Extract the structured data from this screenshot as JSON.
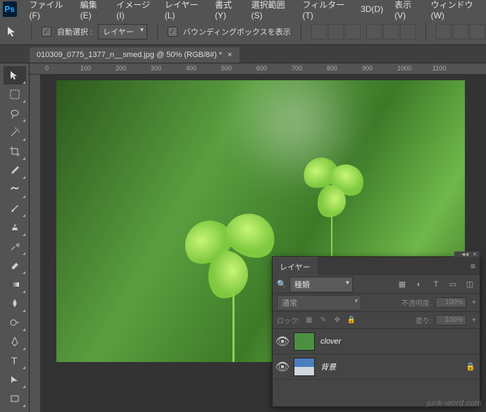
{
  "app": {
    "logo_text": "Ps"
  },
  "menu": [
    "ファイル(F)",
    "編集(E)",
    "イメージ(I)",
    "レイヤー(L)",
    "書式(Y)",
    "選択範囲(S)",
    "フィルター(T)",
    "3D(D)",
    "表示(V)",
    "ウィンドウ(W)"
  ],
  "options": {
    "auto_select_label": "自動選択 :",
    "auto_select_value": "レイヤー",
    "bbox_label": "バウンディングボックスを表示"
  },
  "document": {
    "tab_title": "010309_0775_1377_n__smed.jpg @ 50% (RGB/8#) *",
    "close_glyph": "×"
  },
  "ruler": {
    "ticks": [
      "0",
      "100",
      "200",
      "300",
      "400",
      "500",
      "600",
      "700",
      "800",
      "900",
      "1000",
      "1100"
    ]
  },
  "panel": {
    "title": "レイヤー",
    "filter_label": "種類",
    "filter_value": "種類",
    "blend_mode": "通常",
    "opacity_label": "不透明度:",
    "opacity_value": "100%",
    "lock_label": "ロック:",
    "fill_label": "塗り:",
    "fill_value": "100%",
    "layers": [
      {
        "name": "clover",
        "thumb": "clover",
        "locked": false,
        "visible": true
      },
      {
        "name": "背景",
        "thumb": "sky",
        "locked": true,
        "visible": true
      }
    ]
  },
  "watermark": "junk-word.com",
  "icons": {
    "search": "🔍",
    "eye": "👁",
    "lock": "🔒",
    "menu": "≡",
    "collapse": "◂◂",
    "close": "×"
  }
}
